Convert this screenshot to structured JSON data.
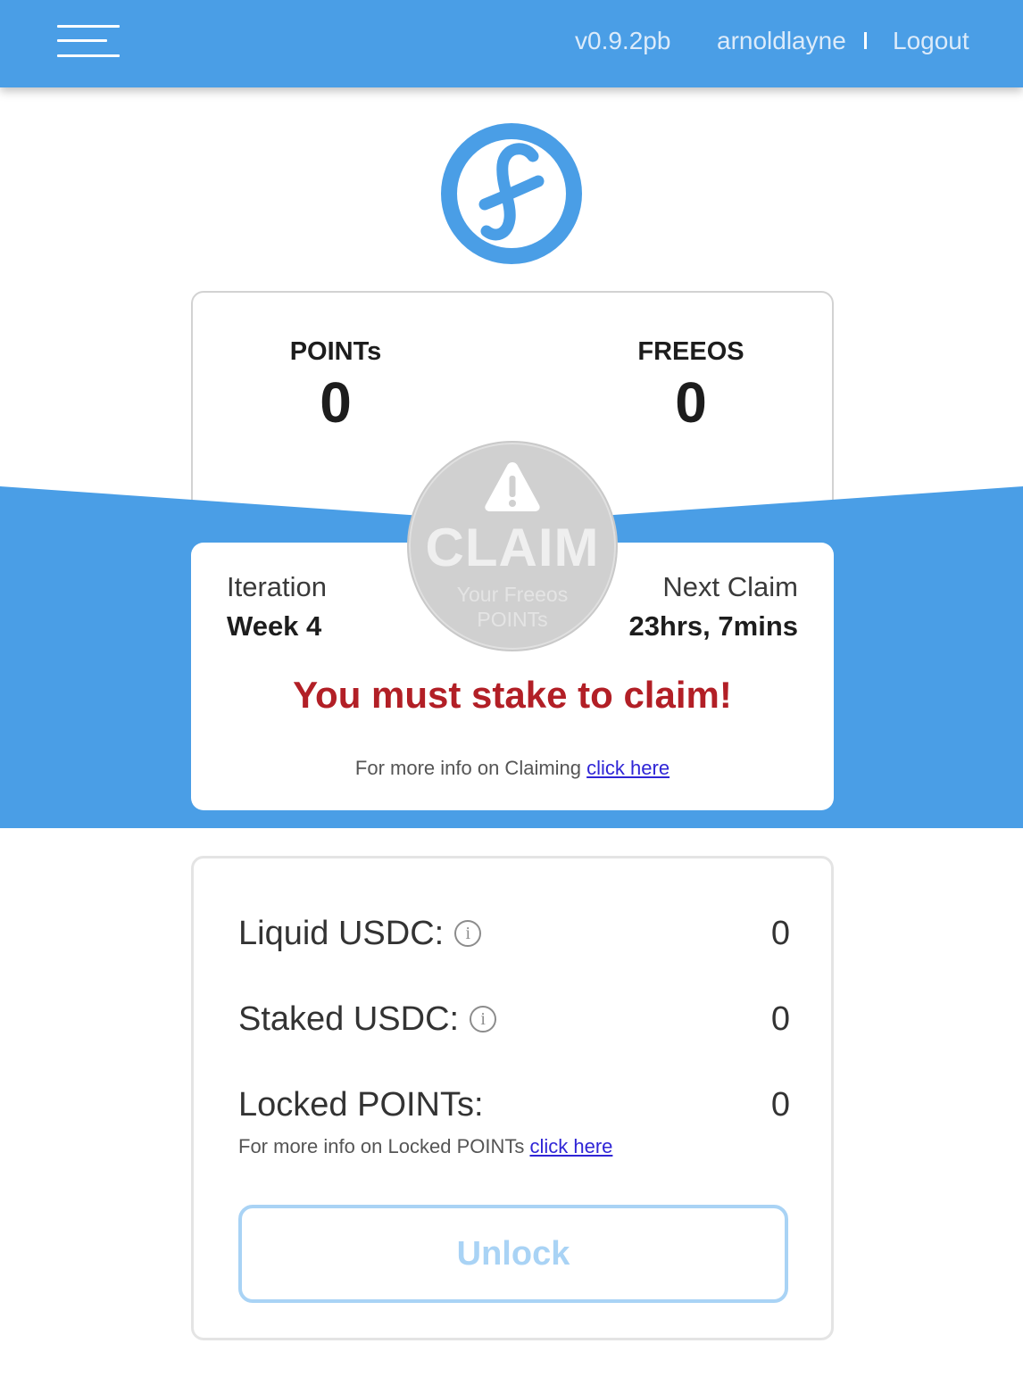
{
  "header": {
    "version": "v0.9.2pb",
    "username": "arnoldlayne",
    "logout_label": "Logout"
  },
  "colors": {
    "brand_blue": "#4a9ee6",
    "warning_red": "#b21f26",
    "link_blue": "#2f25d6",
    "unlock_disabled": "#a9d3f5"
  },
  "stats": {
    "points_label": "POINTs",
    "points_value": "0",
    "freeos_label": "FREEOS",
    "freeos_value": "0"
  },
  "claim_button": {
    "label": "CLAIM",
    "sub_line1": "Your Freeos",
    "sub_line2": "POINTs",
    "state": "disabled"
  },
  "claim_card": {
    "iteration_label": "Iteration",
    "iteration_value": "Week 4",
    "next_claim_label": "Next Claim",
    "next_claim_value": "23hrs, 7mins",
    "warning": "You must stake to claim!",
    "info_text": "For more info on Claiming ",
    "info_link": "click here"
  },
  "balances": {
    "liquid_label": "Liquid USDC:",
    "liquid_value": "0",
    "staked_label": "Staked USDC:",
    "staked_value": "0",
    "locked_label": "Locked POINTs:",
    "locked_value": "0",
    "locked_info_text": "For more info on Locked POINTs ",
    "locked_info_link": "click here",
    "info_icon_glyph": "i",
    "unlock_label": "Unlock"
  }
}
